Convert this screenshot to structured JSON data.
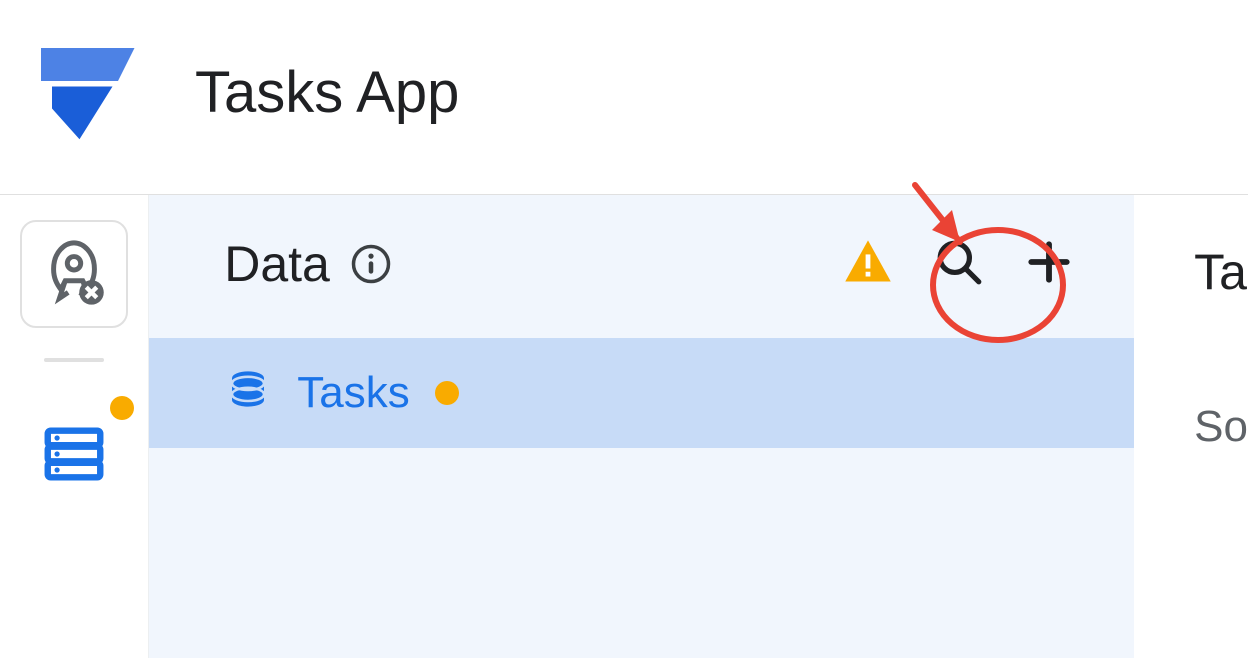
{
  "header": {
    "title": "Tasks App"
  },
  "rail": {
    "items": [
      {
        "name": "deploy",
        "notif": false,
        "active": false
      },
      {
        "name": "data",
        "notif": true,
        "active": true
      }
    ]
  },
  "dataPanel": {
    "title": "Data",
    "tables": [
      {
        "name": "Tasks",
        "hasWarning": true
      }
    ]
  },
  "rightPanel": {
    "headerFragment": "Ta",
    "rowFragment": "So"
  },
  "colors": {
    "brandBlue": "#1a73e8",
    "warningOrange": "#f9ab00",
    "annotationRed": "#ea4335",
    "selectedRow": "#c7dbf7",
    "panelBg": "#f1f6fd"
  }
}
